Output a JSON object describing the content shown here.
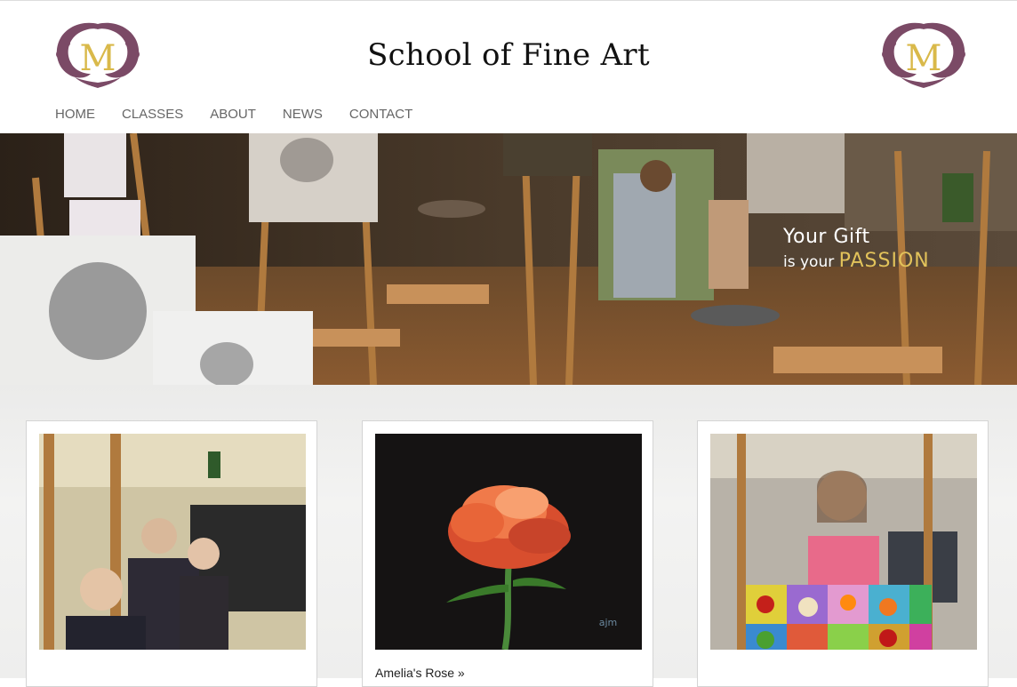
{
  "site": {
    "title": "School of Fine Art",
    "logo_letter": "M",
    "logo_label_left": "logo-left",
    "accent_gold": "#d9b94a",
    "accent_plum": "#7b4a66"
  },
  "nav": {
    "items": [
      {
        "label": "HOME"
      },
      {
        "label": "CLASSES"
      },
      {
        "label": "ABOUT"
      },
      {
        "label": "NEWS"
      },
      {
        "label": "CONTACT"
      }
    ]
  },
  "hero": {
    "tagline_line1": "Your Gift",
    "tagline_prefix": "is your",
    "tagline_highlight": "PASSION"
  },
  "cards": [
    {
      "link": ""
    },
    {
      "link": "Amelia's Rose »",
      "signature": "ajm"
    },
    {
      "link": ""
    }
  ]
}
